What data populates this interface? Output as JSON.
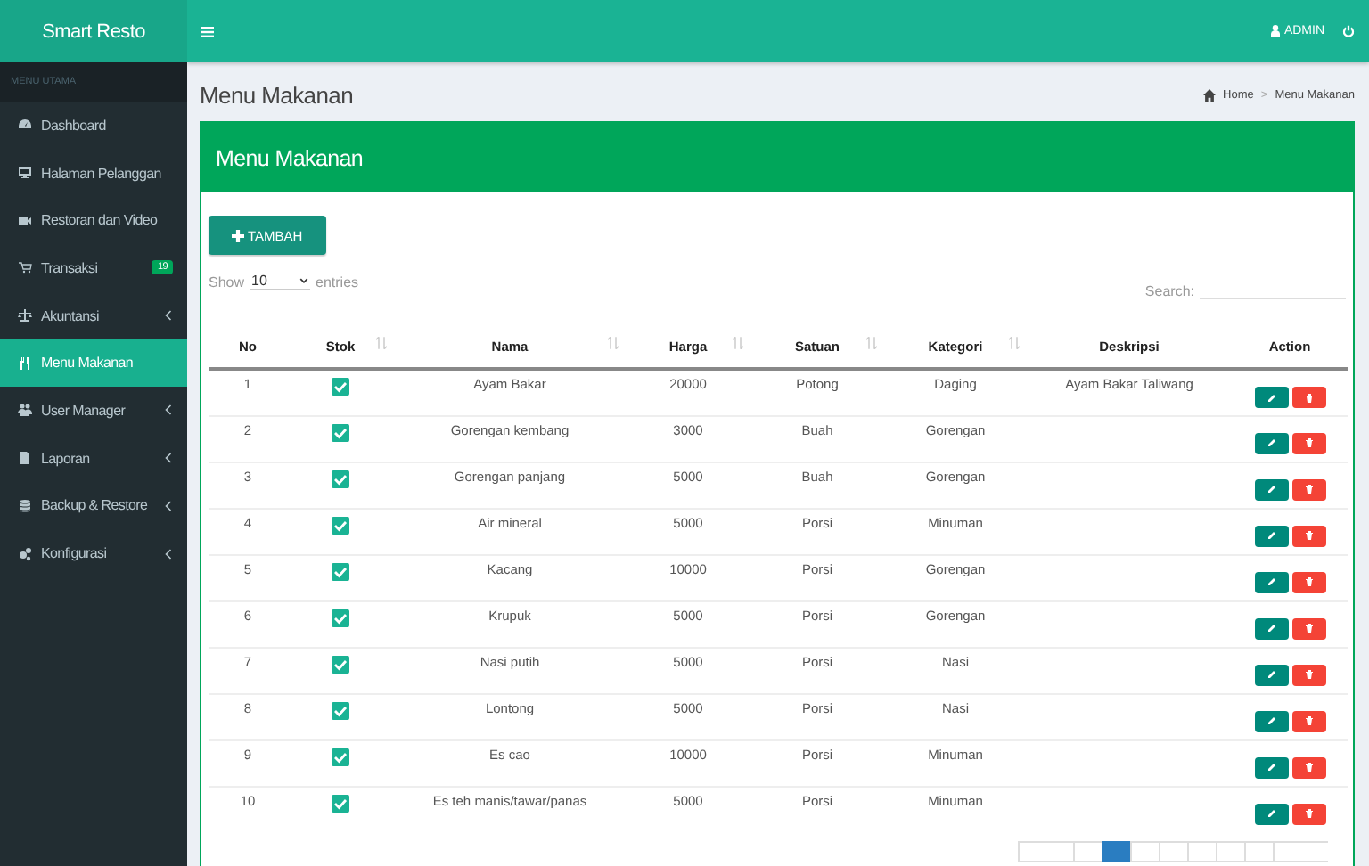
{
  "brand": "Smart Resto",
  "header": {
    "user": "ADMIN"
  },
  "sidebar": {
    "section": "MENU UTAMA",
    "items": [
      {
        "label": "Dashboard",
        "selected": false,
        "expandable": false
      },
      {
        "label": "Halaman Pelanggan",
        "selected": false,
        "expandable": false
      },
      {
        "label": "Restoran dan Video",
        "selected": false,
        "expandable": false
      },
      {
        "label": "Transaksi",
        "selected": false,
        "expandable": false,
        "badge": "19"
      },
      {
        "label": "Akuntansi",
        "selected": false,
        "expandable": true
      },
      {
        "label": "Menu Makanan",
        "selected": true,
        "expandable": false
      },
      {
        "label": "User Manager",
        "selected": false,
        "expandable": true
      },
      {
        "label": "Laporan",
        "selected": false,
        "expandable": true
      },
      {
        "label": "Backup & Restore",
        "selected": false,
        "expandable": true
      },
      {
        "label": "Konfigurasi",
        "selected": false,
        "expandable": true
      }
    ]
  },
  "page_title": "Menu Makanan",
  "breadcrumb": {
    "separator": ">",
    "items": [
      "Home",
      "Menu Makanan"
    ]
  },
  "card": {
    "title": "Menu Makanan",
    "add_button": "TAMBAH",
    "length": {
      "before": "Show",
      "value": "10",
      "after": "entries"
    },
    "search": {
      "label": "Search:"
    },
    "table": {
      "columns": [
        {
          "label": "No",
          "sortable": false
        },
        {
          "label": "Stok",
          "sortable": true
        },
        {
          "label": "Nama",
          "sortable": true
        },
        {
          "label": "Harga",
          "sortable": true
        },
        {
          "label": "Satuan",
          "sortable": true
        },
        {
          "label": "Kategori",
          "sortable": true
        },
        {
          "label": "Deskripsi",
          "sortable": false
        },
        {
          "label": "Action",
          "sortable": false
        }
      ],
      "rows": [
        {
          "no": "1",
          "checked": true,
          "nama": "Ayam Bakar",
          "harga": "20000",
          "satuan": "Potong",
          "kategori": "Daging",
          "deskripsi": "Ayam Bakar Taliwang"
        },
        {
          "no": "2",
          "checked": true,
          "nama": "Gorengan kembang",
          "harga": "3000",
          "satuan": "Buah",
          "kategori": "Gorengan"
        },
        {
          "no": "3",
          "checked": true,
          "nama": "Gorengan panjang",
          "harga": "5000",
          "satuan": "Buah",
          "kategori": "Gorengan"
        },
        {
          "no": "4",
          "checked": true,
          "nama": "Air mineral",
          "harga": "5000",
          "satuan": "Porsi",
          "kategori": "Minuman"
        },
        {
          "no": "5",
          "checked": true,
          "nama": "Kacang",
          "harga": "10000",
          "satuan": "Porsi",
          "kategori": "Gorengan"
        },
        {
          "no": "6",
          "checked": true,
          "nama": "Krupuk",
          "harga": "5000",
          "satuan": "Porsi",
          "kategori": "Gorengan"
        },
        {
          "no": "7",
          "checked": true,
          "nama": "Nasi putih",
          "harga": "5000",
          "satuan": "Porsi",
          "kategori": "Nasi"
        },
        {
          "no": "8",
          "checked": true,
          "nama": "Lontong",
          "harga": "5000",
          "satuan": "Porsi",
          "kategori": "Nasi"
        },
        {
          "no": "9",
          "checked": true,
          "nama": "Es cao",
          "harga": "10000",
          "satuan": "Porsi",
          "kategori": "Minuman"
        },
        {
          "no": "10",
          "checked": true,
          "nama": "Es teh manis/tawar/panas",
          "harga": "5000",
          "satuan": "Porsi",
          "kategori": "Minuman"
        }
      ]
    }
  }
}
